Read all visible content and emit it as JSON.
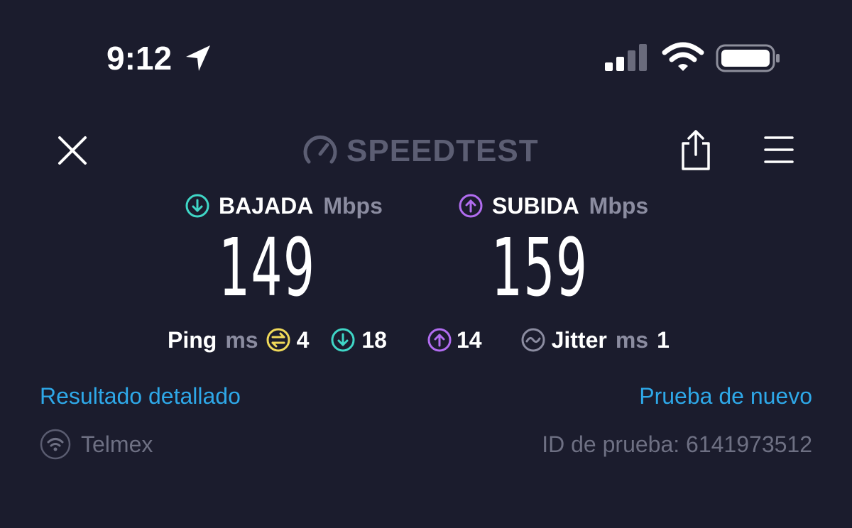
{
  "status_bar": {
    "time": "9:12",
    "location_icon": "location-arrow-icon",
    "signal_icon": "cellular-signal-icon",
    "wifi_icon": "wifi-icon",
    "battery_icon": "battery-icon"
  },
  "top_bar": {
    "close_icon": "close-icon",
    "logo_text": "SPEEDTEST",
    "share_icon": "share-icon",
    "menu_icon": "hamburger-menu-icon"
  },
  "download": {
    "label": "BAJADA",
    "unit": "Mbps",
    "value": "149",
    "color": "#3fd6c6"
  },
  "upload": {
    "label": "SUBIDA",
    "unit": "Mbps",
    "value": "159",
    "color": "#b16cf0"
  },
  "ping": {
    "label": "Ping",
    "unit": "ms",
    "idle": "4",
    "idle_color": "#f0d95a",
    "download": "18",
    "upload": "14"
  },
  "jitter": {
    "label": "Jitter",
    "unit": "ms",
    "value": "1"
  },
  "links": {
    "detailed_result": "Resultado detallado",
    "test_again": "Prueba de nuevo"
  },
  "footer": {
    "isp_name": "Telmex",
    "test_id": "ID de prueba: 6141973512"
  },
  "colors": {
    "background": "#1b1c2d",
    "link": "#2ea8e8",
    "muted": "#8b8ca0"
  }
}
